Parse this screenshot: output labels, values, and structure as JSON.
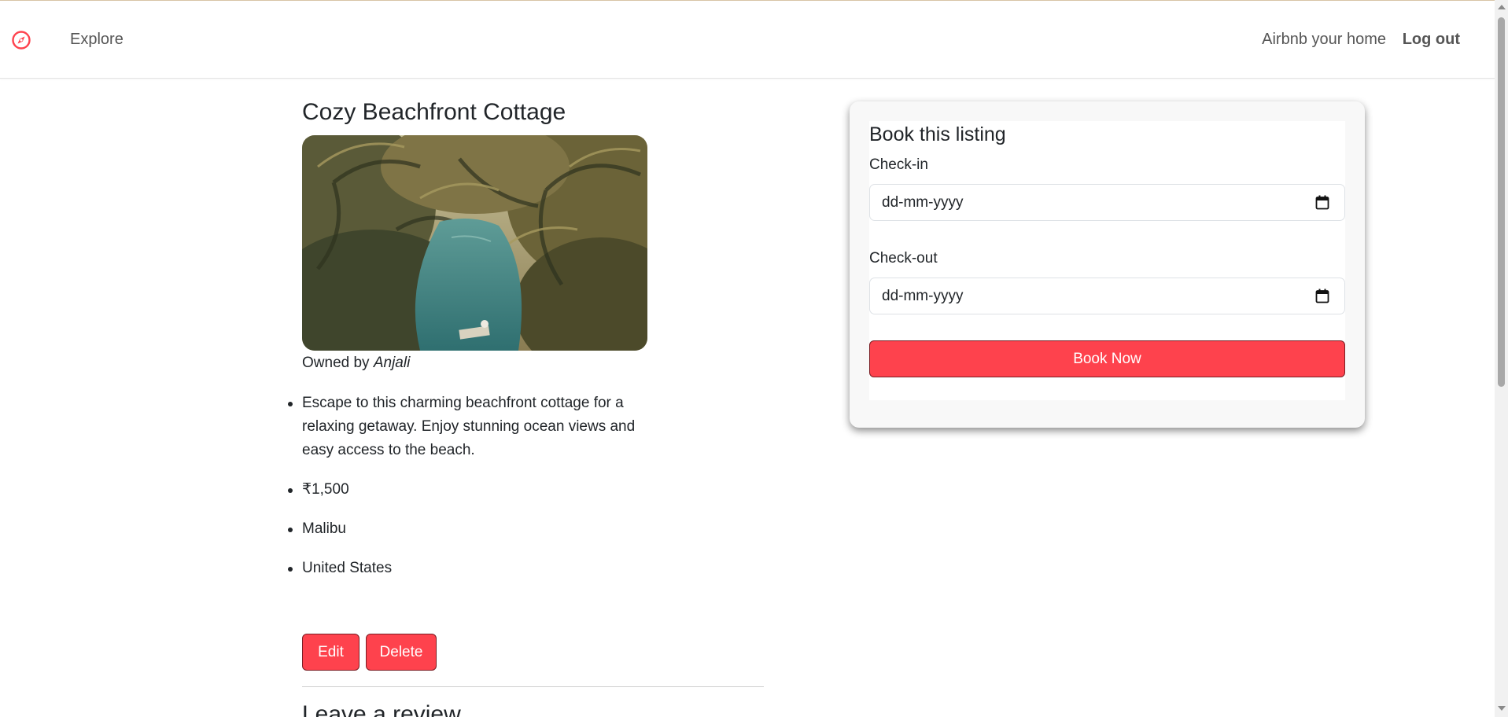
{
  "nav": {
    "brand_icon": "compass-icon",
    "brand_color": "#fe424d",
    "explore_label": "Explore",
    "host_label": "Airbnb your home",
    "logout_label": "Log out"
  },
  "listing": {
    "title": "Cozy Beachfront Cottage",
    "owner_prefix": "Owned by",
    "owner_name": "Anjali",
    "description": "Escape to this charming beachfront cottage for a relaxing getaway. Enjoy stunning ocean views and easy access to the beach.",
    "price": "₹1,500",
    "location": "Malibu",
    "country": "United States",
    "edit_label": "Edit",
    "delete_label": "Delete"
  },
  "booking": {
    "title": "Book this listing",
    "checkin_label": "Check-in",
    "checkin_placeholder": "dd-mm-yyyy",
    "checkout_label": "Check-out",
    "checkout_placeholder": "dd-mm-yyyy",
    "button_label": "Book Now",
    "accent": "#fe424d"
  },
  "review": {
    "heading": "Leave a review"
  }
}
